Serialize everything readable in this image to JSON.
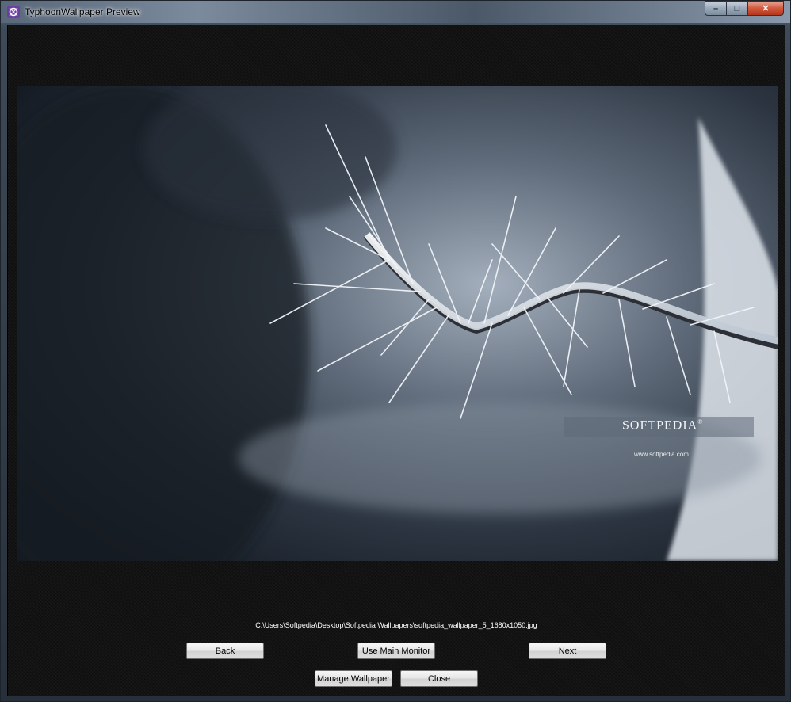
{
  "window": {
    "title": "TyphoonWallpaper Preview",
    "controls": {
      "minimize": "–",
      "maximize": "□",
      "close": "✕"
    }
  },
  "preview": {
    "brand": "SOFTPEDIA",
    "brand_mark": "®",
    "url": "www.softpedia.com"
  },
  "file_path": "C:\\Users\\Softpedia\\Desktop\\Softpedia Wallpapers\\softpedia_wallpaper_5_1680x1050.jpg",
  "buttons": {
    "back": "Back",
    "use_main_monitor": "Use Main Monitor",
    "next": "Next",
    "manage_wallpaper": "Manage Wallpaper",
    "close": "Close"
  },
  "icons": {
    "app": "typhoon-app-icon",
    "minimize": "minimize-icon",
    "maximize": "maximize-icon",
    "close": "close-icon"
  }
}
